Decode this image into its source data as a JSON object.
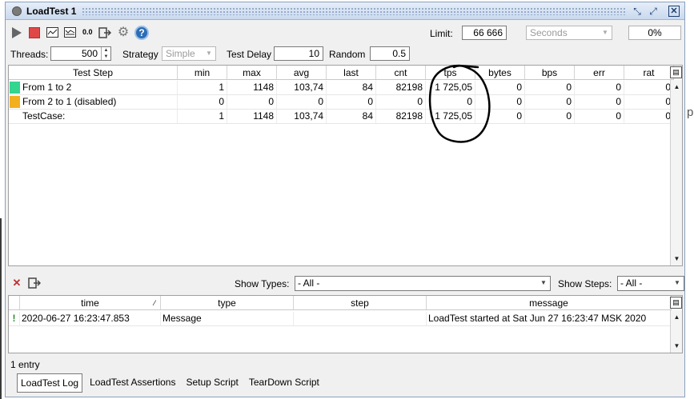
{
  "window": {
    "title": "LoadTest 1"
  },
  "toolbar": {
    "stat_label": "0.0",
    "limit_label": "Limit:",
    "limit_value": "66 666",
    "limit_unit": "Seconds",
    "progress": "0%"
  },
  "params": {
    "threads_label": "Threads:",
    "threads_value": "500",
    "strategy_label": "Strategy",
    "strategy_value": "Simple",
    "delay_label": "Test Delay",
    "delay_value": "10",
    "random_label": "Random",
    "random_value": "0.5"
  },
  "stats_table": {
    "headers": [
      "Test Step",
      "min",
      "max",
      "avg",
      "last",
      "cnt",
      "tps",
      "bytes",
      "bps",
      "err",
      "rat"
    ],
    "rows": [
      {
        "color": "#33d58f",
        "cells": [
          "From 1 to 2",
          "1",
          "1148",
          "103,74",
          "84",
          "82198",
          "1 725,05",
          "0",
          "0",
          "0",
          "0"
        ]
      },
      {
        "color": "#f2b01e",
        "cells": [
          "From 2 to 1 (disabled)",
          "0",
          "0",
          "0",
          "0",
          "0",
          "0",
          "0",
          "0",
          "0",
          "0"
        ]
      },
      {
        "color": "",
        "cells": [
          "TestCase:",
          "1",
          "1148",
          "103,74",
          "84",
          "82198",
          "1 725,05",
          "0",
          "0",
          "0",
          "0"
        ]
      }
    ]
  },
  "log_filters": {
    "types_label": "Show Types:",
    "types_value": "- All -",
    "steps_label": "Show Steps:",
    "steps_value": "- All -"
  },
  "log_table": {
    "headers": [
      "time",
      "type",
      "step",
      "message"
    ],
    "rows": [
      {
        "cells": [
          "2020-06-27 16:23:47.853",
          "Message",
          "",
          "LoadTest started at Sat Jun 27 16:23:47 MSK 2020"
        ]
      }
    ]
  },
  "entry_count": "1 entry",
  "tabs": [
    "LoadTest Log",
    "LoadTest Assertions",
    "Setup Script",
    "TearDown Script"
  ],
  "colors": {
    "title_bar": "#c9d9ee",
    "stop": "#e04848",
    "help": "#2d6db6"
  },
  "outer_fragment": "p"
}
